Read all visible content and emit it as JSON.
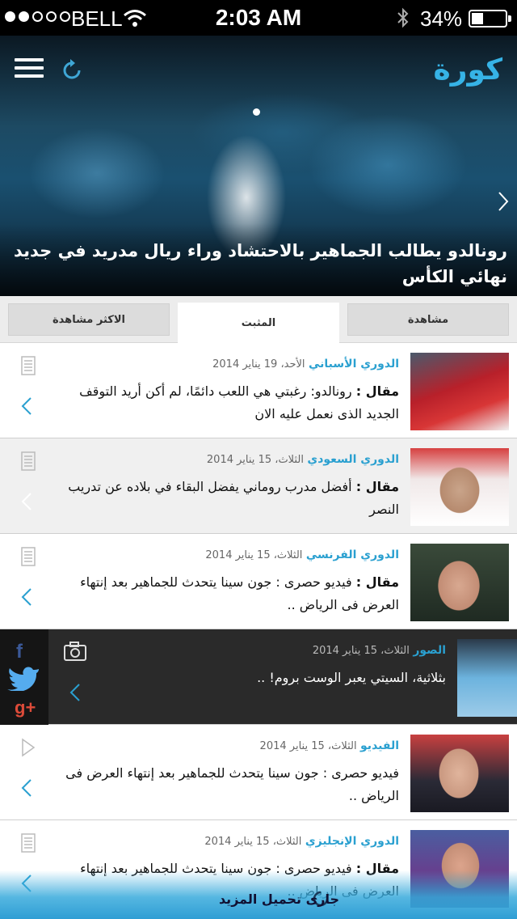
{
  "status_bar": {
    "carrier": "BELL",
    "time": "2:03 AM",
    "battery": "34%",
    "battery_level": 0.34,
    "signal_bars_filled": 2,
    "signal_bars_total": 5
  },
  "header": {
    "logo": "كورة",
    "menu_icon": "hamburger-icon",
    "refresh_icon": "refresh-icon"
  },
  "hero": {
    "headline": "رونالدو يطالب الجماهير بالاحتشاد وراء ريال مدريد في جديد نهائي الكأس"
  },
  "tabs": {
    "most_viewed": "الاكثر مشاهدة",
    "pinned": "المثبت",
    "views": "مشاهدة",
    "active": "pinned"
  },
  "articles": [
    {
      "category": "الدوري الأسباني",
      "date": "الأحد، 19 يناير 2014",
      "prefix": "مقال :",
      "title": "رونالدو: رغبتي هي اللعب دائمًا، لم أكن أريد التوقف الجديد الذى نعمل عليه الان",
      "type_icon": "document-icon"
    },
    {
      "category": "الدوري السعودي",
      "date": "الثلاث، 15 يناير 2014",
      "prefix": "مقال :",
      "title": "أفضل مدرب روماني يفضل البقاء في بلاده عن تدريب النصر",
      "type_icon": "document-icon"
    },
    {
      "category": "الدوري الفرنسي",
      "date": "الثلاث، 15 يناير 2014",
      "prefix": "مقال :",
      "title": "فيديو حصرى : جون سينا يتحدث للجماهير بعد إنتهاء العرض فى الرياض ..",
      "type_icon": "document-icon"
    },
    {
      "category": "الصور",
      "date": "الثلاث، 15 يناير 2014",
      "prefix": "",
      "title": "بثلاثية، السيتي يعبر الوست بروم! ..",
      "type_icon": "camera-icon"
    },
    {
      "category": "الفيديو",
      "date": "الثلاث، 15 يناير 2014",
      "prefix": "",
      "title": "فيديو حصرى : جون سينا يتحدث للجماهير بعد إنتهاء العرض فى الرياض ..",
      "type_icon": "play-icon"
    },
    {
      "category": "الدوري الإنجليزي",
      "date": "الثلاث، 15 يناير 2014",
      "prefix": "مقال :",
      "title": "فيديو حصرى : جون سينا يتحدث للجماهير بعد إنتهاء العرض فى الرياض ..",
      "type_icon": "document-icon"
    }
  ],
  "social": {
    "facebook": "f",
    "googleplus": "g+"
  },
  "loading": {
    "text": "جارى تحميل المزيد"
  },
  "colors": {
    "accent": "#2aa0d0",
    "logo": "#36b3e6",
    "dark_row": "#2a2a2a",
    "facebook": "#3b5998",
    "twitter": "#55acee",
    "googleplus": "#dd4b39"
  }
}
